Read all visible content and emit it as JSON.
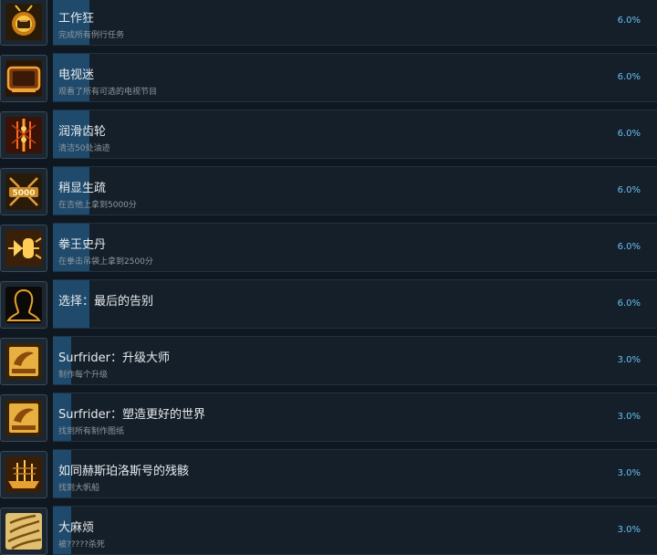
{
  "accent_color": "#66c0f4",
  "fill_color": "#1f4a6b",
  "achievements": [
    {
      "name": "工作狂",
      "desc": "完成所有例行任务",
      "percent_text": "6.0%",
      "percent": 6.0,
      "icon": "briefcase-icon"
    },
    {
      "name": "电视迷",
      "desc": "观看了所有可选的电视节目",
      "percent_text": "6.0%",
      "percent": 6.0,
      "icon": "tv-icon"
    },
    {
      "name": "润滑齿轮",
      "desc": "清洁50处油迹",
      "percent_text": "6.0%",
      "percent": 6.0,
      "icon": "oil-drops-icon"
    },
    {
      "name": "稍显生疏",
      "desc": "在吉他上拿到5000分",
      "percent_text": "6.0%",
      "percent": 6.0,
      "icon": "guitar-5000-icon"
    },
    {
      "name": "拳王史丹",
      "desc": "在拳击吊袋上拿到2500分",
      "percent_text": "6.0%",
      "percent": 6.0,
      "icon": "punching-bag-icon"
    },
    {
      "name": "选择：最后的告别",
      "desc": "",
      "percent_text": "6.0%",
      "percent": 6.0,
      "icon": "silhouette-icon"
    },
    {
      "name": "Surfrider：升级大师",
      "desc": "制作每个升级",
      "percent_text": "3.0%",
      "percent": 3.0,
      "icon": "surfrider-icon"
    },
    {
      "name": "Surfrider：塑造更好的世界",
      "desc": "找到所有制作图纸",
      "percent_text": "3.0%",
      "percent": 3.0,
      "icon": "surfrider-icon"
    },
    {
      "name": "如同赫斯珀洛斯号的残骸",
      "desc": "找到大帆船",
      "percent_text": "3.0%",
      "percent": 3.0,
      "icon": "ship-icon"
    },
    {
      "name": "大麻烦",
      "desc": "被?????杀死",
      "percent_text": "3.0%",
      "percent": 3.0,
      "icon": "claw-marks-icon"
    }
  ]
}
